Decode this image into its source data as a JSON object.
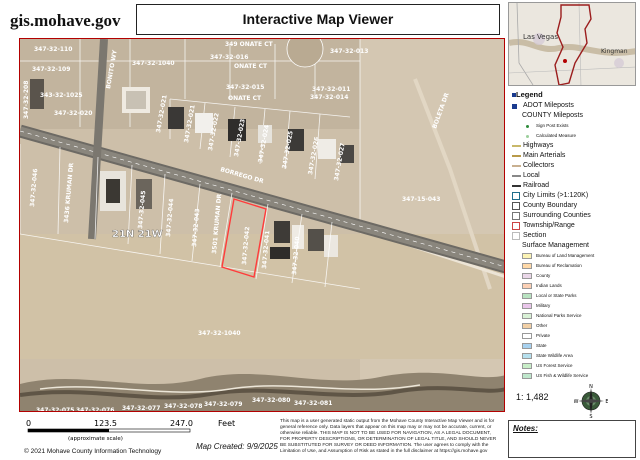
{
  "header": {
    "site": "gis.mohave.gov",
    "title": "Interactive Map Viewer"
  },
  "map": {
    "parcels": {
      "top": [
        "347-32-110",
        "347-32-109",
        "347-32-1040",
        "349 ONATE CT",
        "347-32-016",
        "347-32-015",
        "347-32-013",
        "347-32-011",
        "347-32-014",
        "343-32-1025",
        "347-32-208"
      ],
      "roads": [
        "BONITO WY",
        "BOLETA DR",
        "ONATE CT",
        "BORREGO DR",
        "ONATE CT"
      ],
      "mid": [
        "347-32-020",
        "347-32-021",
        "347-32-021",
        "347-32-022",
        "347-32-023",
        "347-32-024",
        "347-32-025",
        "347-32-026",
        "347-32-027",
        "347-32-028",
        "347-32-029",
        "347-15-043"
      ],
      "lower": [
        "347-32-046",
        "3436 KRUMAN DR",
        "347-32-045",
        "347-32-044",
        "347-32-043",
        "3501 KRUMAN DR",
        "347-32-042",
        "347-32-041",
        "347-32-040",
        "347-32-038",
        "347-32-035"
      ],
      "township": "21N 21W",
      "big": "347-32-1040",
      "bottom": [
        "347-32-075",
        "347-32-076",
        "347-32-077",
        "347-32-078",
        "347-32-079",
        "347-32-080",
        "347-32-081"
      ]
    }
  },
  "legend": {
    "title": "Legend",
    "items": [
      {
        "label": "ADOT Mileposts",
        "kind": "header-dot",
        "color": "#1a3b8f"
      },
      {
        "label": "COUNTY Mileposts",
        "kind": "header",
        "color": ""
      },
      {
        "label": "Sign Post Exists",
        "kind": "dot-small",
        "color": "#2e8b3a"
      },
      {
        "label": "Calculated Measure",
        "kind": "dot-small",
        "color": "#9bcf9b"
      },
      {
        "label": "Highways",
        "kind": "line",
        "color": "#c8b86a"
      },
      {
        "label": "Main Arterials",
        "kind": "line",
        "color": "#b89a4a"
      },
      {
        "label": "Collectors",
        "kind": "line",
        "color": "#c8b090"
      },
      {
        "label": "Local",
        "kind": "line",
        "color": "#888888"
      },
      {
        "label": "Railroad",
        "kind": "line",
        "color": "#333333"
      },
      {
        "label": "City Limits (>1:120K)",
        "kind": "box",
        "color": "#1f6e8c"
      },
      {
        "label": "County Boundary",
        "kind": "box",
        "color": "#555555"
      },
      {
        "label": "Surrounding Counties",
        "kind": "box",
        "color": "#777777"
      },
      {
        "label": "Township/Range",
        "kind": "box",
        "color": "#cc4444"
      },
      {
        "label": "Section",
        "kind": "box",
        "color": "#bbbbbb"
      },
      {
        "label": "Surface Management",
        "kind": "header",
        "color": ""
      },
      {
        "label": "Bureau of Land Management",
        "kind": "fill",
        "color": "#fbf3b5"
      },
      {
        "label": "Bureau of Reclamation",
        "kind": "fill",
        "color": "#ffd9a8"
      },
      {
        "label": "County",
        "kind": "fill",
        "color": "#ead7e8"
      },
      {
        "label": "Indian Lands",
        "kind": "fill",
        "color": "#fbd0b5"
      },
      {
        "label": "Local or State Parks",
        "kind": "fill",
        "color": "#b9e3c1"
      },
      {
        "label": "Military",
        "kind": "fill",
        "color": "#e9c6ea"
      },
      {
        "label": "National Parks Service",
        "kind": "fill",
        "color": "#d9f1d6"
      },
      {
        "label": "Other",
        "kind": "fill",
        "color": "#f2d0a6"
      },
      {
        "label": "Private",
        "kind": "fill",
        "color": "#ffffff"
      },
      {
        "label": "State",
        "kind": "fill",
        "color": "#a8d2f0"
      },
      {
        "label": "State Wildlife Area",
        "kind": "fill",
        "color": "#b6e0ee"
      },
      {
        "label": "US Forest Service",
        "kind": "fill",
        "color": "#c8eec8"
      },
      {
        "label": "US Fish & Wildlife Service",
        "kind": "fill",
        "color": "#bfe7cc"
      }
    ]
  },
  "inset": {
    "labels": [
      "Las Vegas",
      "Kingman"
    ]
  },
  "scale": {
    "ratio": "1: 1,482",
    "ticks": [
      "0",
      "123.5",
      "247.0"
    ],
    "unit": "Feet",
    "note": "(approximate scale)"
  },
  "map_created": "Map Created: 9/9/2025",
  "copyright": "© 2021 Mohave County Information Technology",
  "disclaimer": "This map is a user generated static output from the Mohave County Interactive Map Viewer and is for general reference only. Data layers that appear on this map may or may not be accurate, current, or otherwise reliable. THIS MAP IS NOT TO BE USED FOR NAVIGATION, AS A LEGAL DOCUMENT, FOR PROPERTY DESCRIPTIONS, OR DETERMINATION OF LEGAL TITLE, AND SHOULD NEVER BE SUBSTITUTED FOR SURVEY OR DEED INFORMATION. The user agrees to comply with the Limitation of Use, and Assumption of Risk as stated in the full disclaimer at https://gis.mohave.gov",
  "notes_label": "Notes:",
  "north": {
    "letters": [
      "N",
      "S",
      "E",
      "W"
    ]
  }
}
